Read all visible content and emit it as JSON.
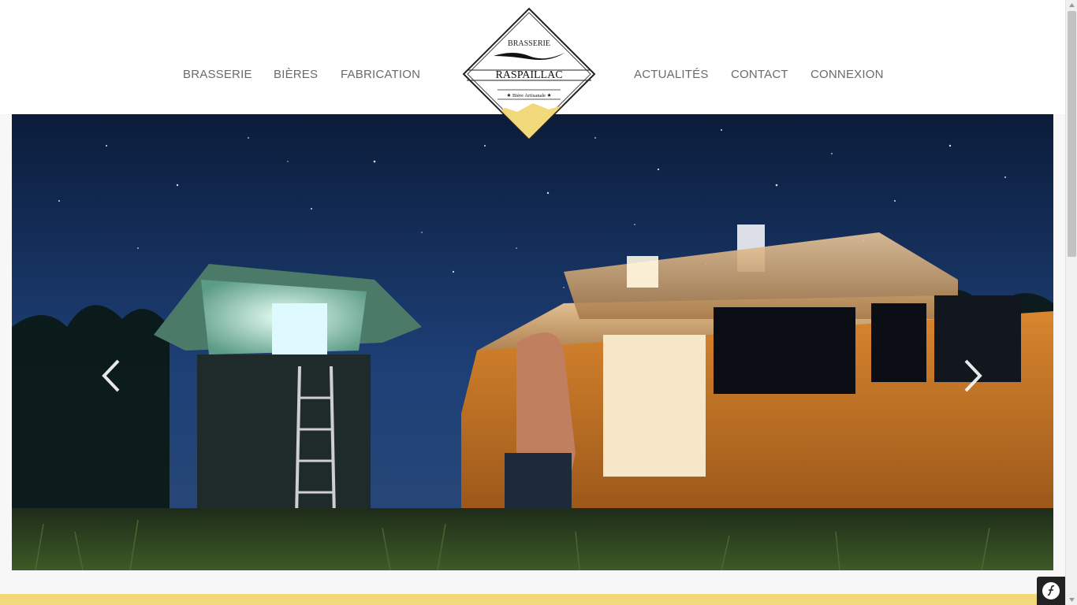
{
  "nav": {
    "left": [
      {
        "label": "BRASSERIE"
      },
      {
        "label": "BIÈRES"
      },
      {
        "label": "FABRICATION"
      }
    ],
    "right": [
      {
        "label": "ACTUALITÉS"
      },
      {
        "label": "CONTACT"
      },
      {
        "label": "CONNEXION"
      }
    ]
  },
  "logo": {
    "line1": "BRASSERIE",
    "line2": "RASPAILLAC",
    "tagline": "★ Bière Artisanale ★"
  },
  "carousel": {
    "image": "night-camping-van-under-stars",
    "prev_icon": "chevron-left-icon",
    "next_icon": "chevron-right-icon"
  },
  "colors": {
    "nav_text": "#6a6a6a",
    "accent_yellow": "#f1d97b",
    "header_bg": "#ffffff"
  },
  "toolbar": {
    "icon": "symfony-icon"
  }
}
